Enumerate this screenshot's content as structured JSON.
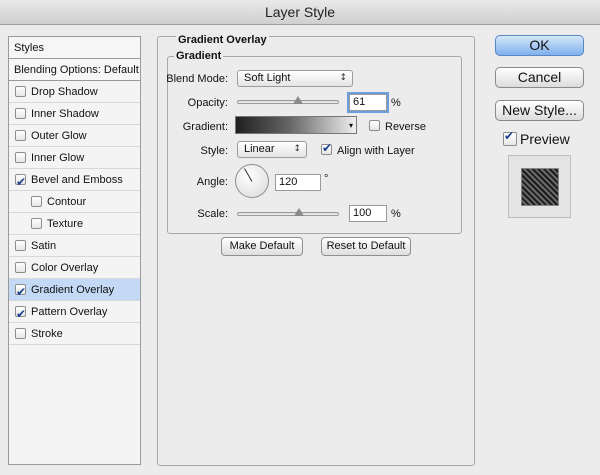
{
  "window": {
    "title": "Layer Style"
  },
  "sidebar": {
    "header": "Styles",
    "blending": "Blending Options: Default",
    "items": [
      {
        "label": "Drop Shadow",
        "checked": false
      },
      {
        "label": "Inner Shadow",
        "checked": false
      },
      {
        "label": "Outer Glow",
        "checked": false
      },
      {
        "label": "Inner Glow",
        "checked": false
      },
      {
        "label": "Bevel and Emboss",
        "checked": true
      },
      {
        "label": "Contour",
        "checked": false
      },
      {
        "label": "Texture",
        "checked": false
      },
      {
        "label": "Satin",
        "checked": false
      },
      {
        "label": "Color Overlay",
        "checked": false
      },
      {
        "label": "Gradient Overlay",
        "checked": true
      },
      {
        "label": "Pattern Overlay",
        "checked": true
      },
      {
        "label": "Stroke",
        "checked": false
      }
    ]
  },
  "panel": {
    "title": "Gradient Overlay",
    "section": "Gradient",
    "blend_mode_label": "Blend Mode:",
    "blend_mode_value": "Soft Light",
    "opacity_label": "Opacity:",
    "opacity_value": "61",
    "opacity_unit": "%",
    "gradient_label": "Gradient:",
    "reverse_label": "Reverse",
    "reverse_checked": false,
    "style_label": "Style:",
    "style_value": "Linear",
    "align_label": "Align with Layer",
    "align_checked": true,
    "angle_label": "Angle:",
    "angle_value": "120",
    "angle_unit": "°",
    "scale_label": "Scale:",
    "scale_value": "100",
    "scale_unit": "%",
    "make_default": "Make Default",
    "reset_default": "Reset to Default"
  },
  "actions": {
    "ok": "OK",
    "cancel": "Cancel",
    "new_style": "New Style...",
    "preview_label": "Preview",
    "preview_checked": true
  },
  "colors": {
    "accent": "#7fb0ec",
    "selection": "#c3d9f5",
    "check": "#1a3f8c"
  },
  "icons": {
    "dropdown": "chevron-updown-icon",
    "checkbox": "checkmark-icon"
  }
}
